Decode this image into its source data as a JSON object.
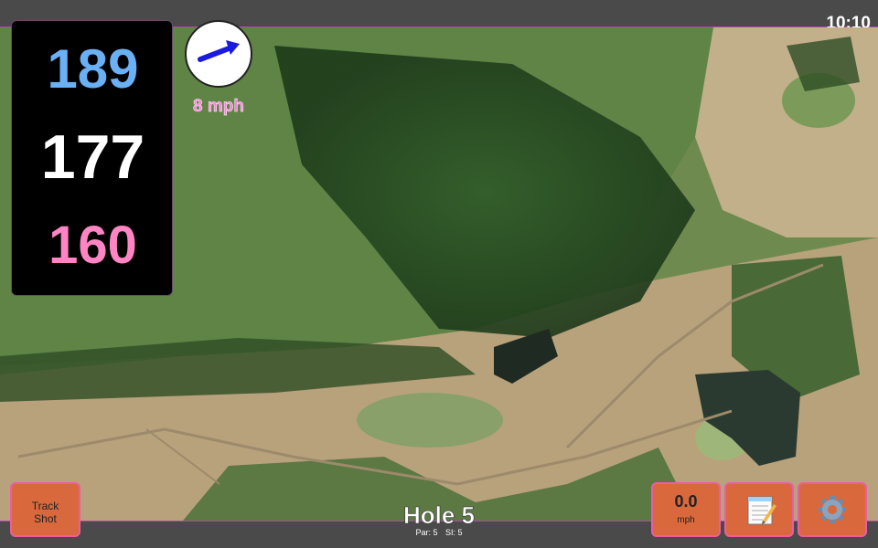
{
  "status_bar": {
    "time": "10:10"
  },
  "yardages": {
    "back": "189",
    "middle": "177",
    "front": "160"
  },
  "wind": {
    "speed_label": "8 mph",
    "direction": "arrow-right-up-icon"
  },
  "buttons": {
    "track_shot_line1": "Track",
    "track_shot_line2": "Shot",
    "speed_value": "0.0",
    "speed_unit": "mph",
    "notes_icon": "notepad-icon",
    "settings_icon": "gear-icon"
  },
  "hole": {
    "title": "Hole 5",
    "par_label": "Par: 5",
    "si_label": "SI: 5"
  },
  "colors": {
    "back_yardage": "#6ab0f5",
    "middle_yardage": "#ffffff",
    "front_yardage": "#ff84c4",
    "button": "#d9683c",
    "button_border": "#ec5ca6",
    "bar": "#4a4a4a"
  }
}
